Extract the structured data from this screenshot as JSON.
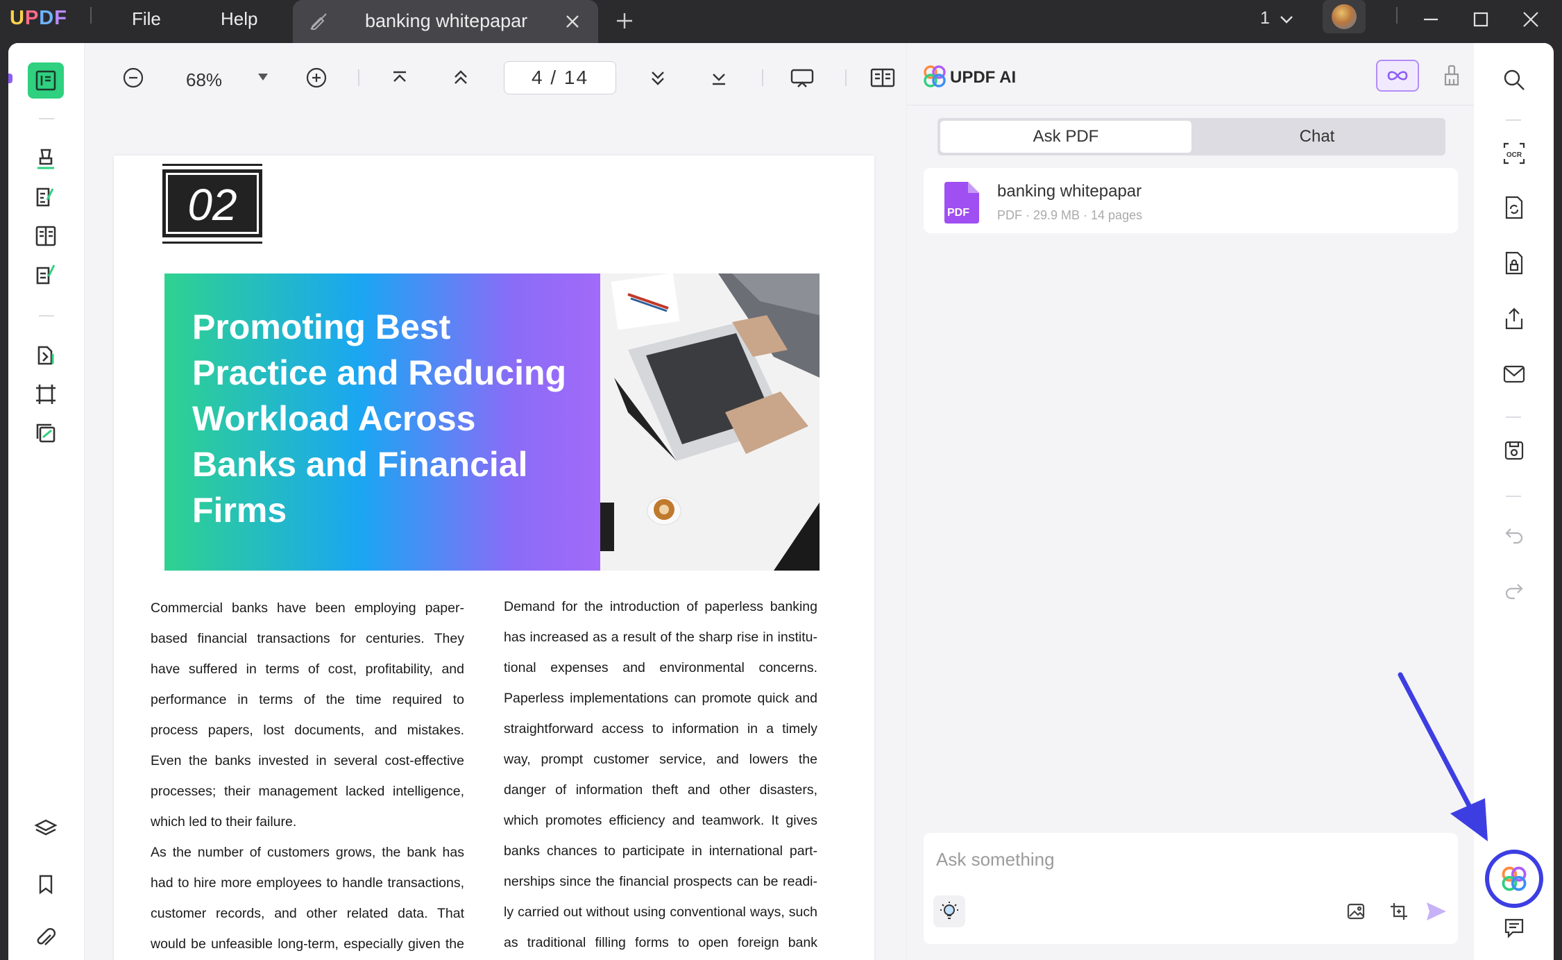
{
  "titlebar": {
    "logo": "UPDF",
    "menu": [
      "File",
      "Help"
    ],
    "tab_title": "banking whitepapar",
    "window_count": "1"
  },
  "toolbar": {
    "zoom": "68%",
    "page_current": "4",
    "page_total": "14",
    "page_label": "4  /  14"
  },
  "document": {
    "chapter": "02",
    "banner_title": "Promoting Best Practice and Reducing Workload Across Banks and Financial Firms",
    "col1_para1": "Commercial banks have been employing paper-based financial transactions for centuries. They have suffered in terms of cost, profitability, and performance in terms of the time required to process papers, lost documents, and mistakes. Even the banks invested in several cost-effective processes; their management lacked intelligence, which led to their failure.",
    "col1_para2": "As the number of customers grows, the bank has had to hire more employees to handle transactions, customer records, and other related data. That would be unfeasible long-term, especially given the bank's current unstable liquidity position (Kumari,",
    "col2_para1": "Demand for the introduction of paperless banking has increased as a result of the sharp rise in institu-tional expenses and environmental concerns. Paperless implementations can promote quick and straightforward access to information in a timely way, prompt customer service, and lowers the danger of information theft and other disasters, which promotes efficiency and teamwork. It gives banks chances to participate in international part-nerships since the financial prospects can be readi-ly carried out without using conventional ways, such as traditional filling forms to open foreign bank accounts, which are problematic and create gaps"
  },
  "ai_panel": {
    "title": "UPDF AI",
    "tabs": [
      "Ask PDF",
      "Chat"
    ],
    "active_tab": "Ask PDF",
    "file": {
      "name": "banking whitepapar",
      "badge": "PDF",
      "meta": "PDF · 29.9 MB · 14 pages"
    },
    "input_placeholder": "Ask something"
  },
  "colors": {
    "accent_green": "#2fd07f",
    "ai_purple": "#b28cf7",
    "highlight_blue": "#3d3ee2"
  }
}
